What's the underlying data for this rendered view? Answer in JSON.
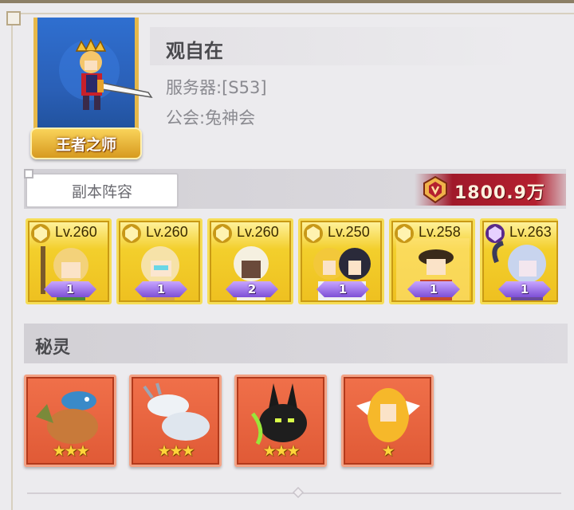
{
  "profile": {
    "name": "观自在",
    "server": "服务器:[S53]",
    "guild": "公会:兔神会",
    "title_badge": "王者之师"
  },
  "lineup": {
    "tab_label": "副本阵容",
    "power": "1800.9万",
    "heroes": [
      {
        "level": "Lv.260",
        "stars": "1",
        "faction": "gold-shield"
      },
      {
        "level": "Lv.260",
        "stars": "1",
        "faction": "gold-shield"
      },
      {
        "level": "Lv.260",
        "stars": "2",
        "faction": "gold-shield"
      },
      {
        "level": "Lv.250",
        "stars": "1",
        "faction": "gold-shield"
      },
      {
        "level": "Lv.258",
        "stars": "1",
        "faction": "gold-shield"
      },
      {
        "level": "Lv.263",
        "stars": "1",
        "faction": "purple-shield"
      }
    ]
  },
  "spirits": {
    "title": "秘灵",
    "items": [
      {
        "stars": "★★★",
        "name": "dragon-spirit"
      },
      {
        "stars": "★★★",
        "name": "white-dragon-spirit"
      },
      {
        "stars": "★★★",
        "name": "dark-rabbit-spirit"
      },
      {
        "stars": "★",
        "name": "golden-angel-spirit"
      }
    ]
  },
  "colors": {
    "panel_bg": "#ecebee",
    "hero_card_gold": "#f3cf2c",
    "spirit_card_red": "#e05a36",
    "power_banner": "#b4202f"
  }
}
